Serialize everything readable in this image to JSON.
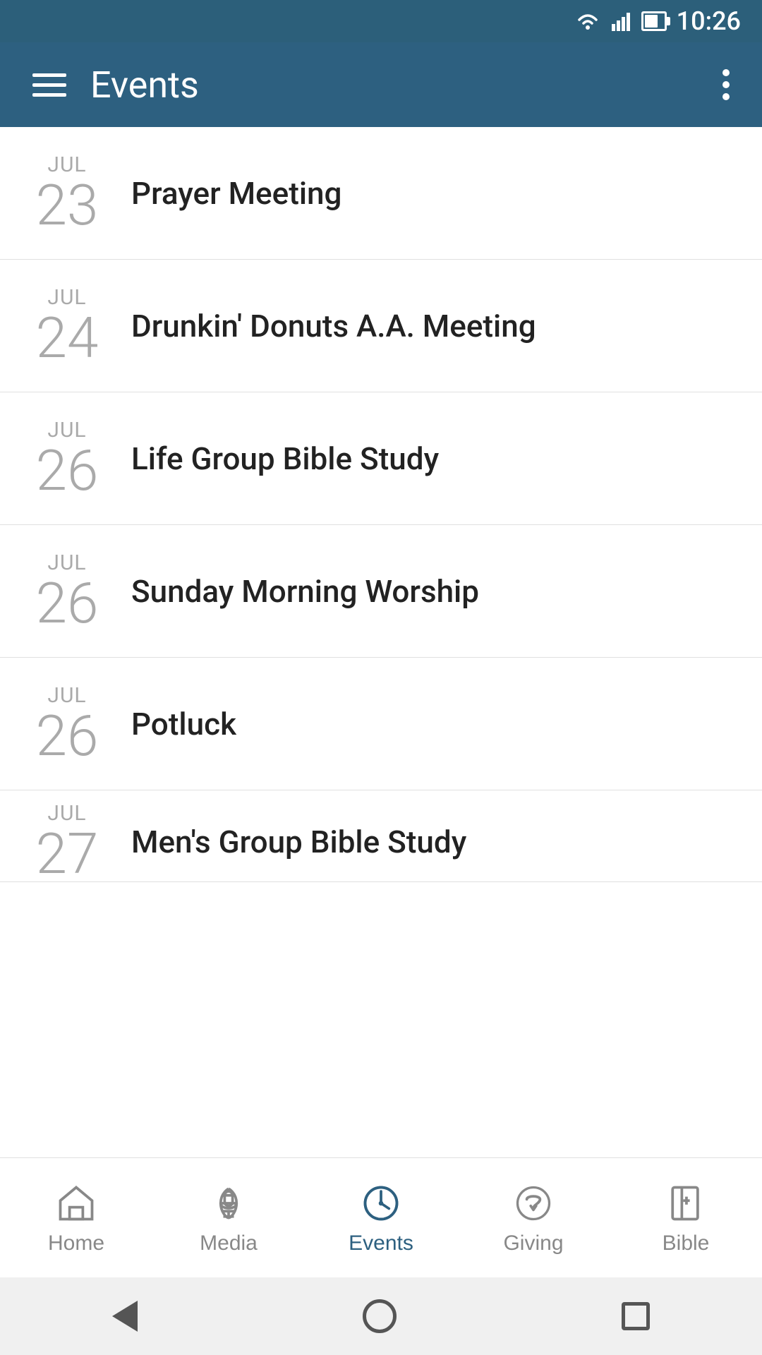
{
  "statusBar": {
    "time": "10:26"
  },
  "appBar": {
    "title": "Events",
    "menuLabel": "menu",
    "moreLabel": "more options"
  },
  "events": [
    {
      "month": "JUL",
      "day": "23",
      "name": "Prayer Meeting"
    },
    {
      "month": "JUL",
      "day": "24",
      "name": "Drunkin' Donuts A.A. Meeting"
    },
    {
      "month": "JUL",
      "day": "26",
      "name": "Life Group Bible Study"
    },
    {
      "month": "JUL",
      "day": "26",
      "name": "Sunday Morning Worship"
    },
    {
      "month": "JUL",
      "day": "26",
      "name": "Potluck"
    },
    {
      "month": "JUL",
      "day": "27",
      "name": "Men's Group Bible Study"
    }
  ],
  "bottomNav": {
    "items": [
      {
        "id": "home",
        "label": "Home",
        "active": false
      },
      {
        "id": "media",
        "label": "Media",
        "active": false
      },
      {
        "id": "events",
        "label": "Events",
        "active": true
      },
      {
        "id": "giving",
        "label": "Giving",
        "active": false
      },
      {
        "id": "bible",
        "label": "Bible",
        "active": false
      }
    ]
  },
  "colors": {
    "appBar": "#2d6080",
    "activeNav": "#2d6080",
    "inactiveNav": "#888888"
  }
}
